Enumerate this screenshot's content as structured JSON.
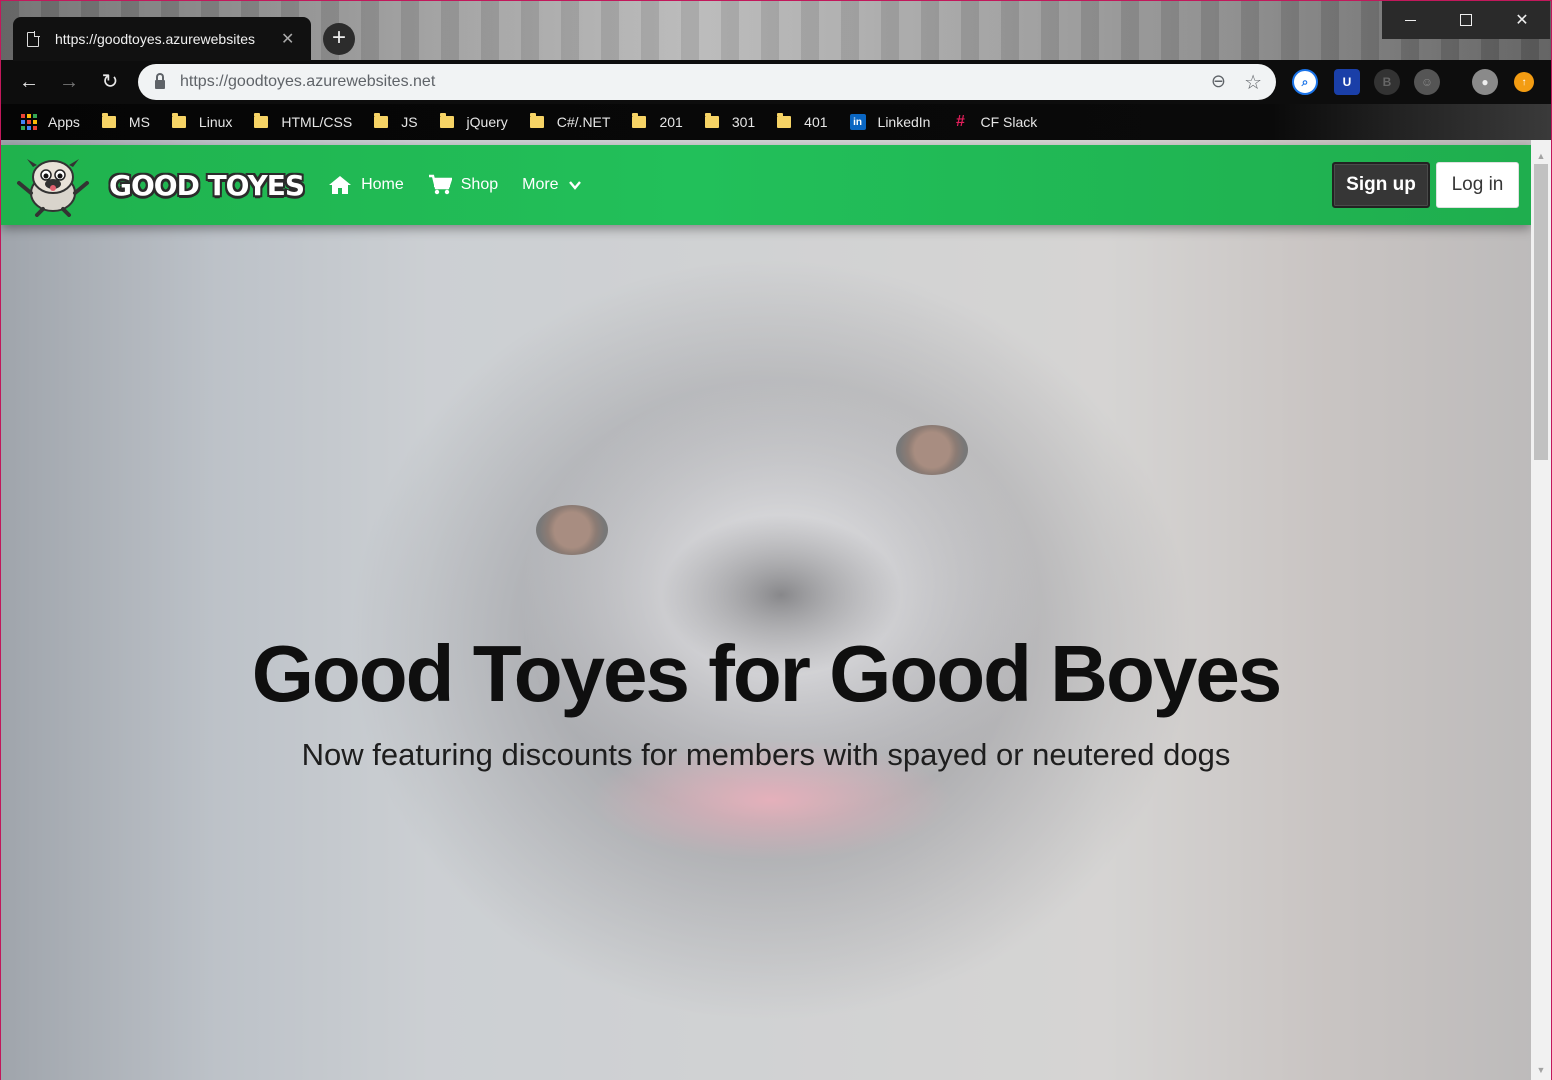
{
  "browser": {
    "tab_title": "https://goodtoyes.azurewebsites",
    "url": "https://goodtoyes.azurewebsites.net",
    "bookmarks": [
      {
        "label": "Apps",
        "icon": "apps-grid-icon"
      },
      {
        "label": "MS",
        "icon": "folder-icon"
      },
      {
        "label": "Linux",
        "icon": "folder-icon"
      },
      {
        "label": "HTML/CSS",
        "icon": "folder-icon"
      },
      {
        "label": "JS",
        "icon": "folder-icon"
      },
      {
        "label": "jQuery",
        "icon": "folder-icon"
      },
      {
        "label": "C#/.NET",
        "icon": "folder-icon"
      },
      {
        "label": "201",
        "icon": "folder-icon"
      },
      {
        "label": "301",
        "icon": "folder-icon"
      },
      {
        "label": "401",
        "icon": "folder-icon"
      },
      {
        "label": "LinkedIn",
        "icon": "linkedin-icon"
      },
      {
        "label": "CF Slack",
        "icon": "slack-icon"
      }
    ]
  },
  "site": {
    "brand": "GOOD TOYES",
    "nav": [
      {
        "label": "Home",
        "icon": "home-icon"
      },
      {
        "label": "Shop",
        "icon": "cart-icon"
      },
      {
        "label": "More",
        "icon": "chevron-down-icon"
      }
    ],
    "signup_label": "Sign up",
    "login_label": "Log in",
    "hero_title": "Good Toyes for Good Boyes",
    "hero_subtitle": "Now featuring discounts for members with spayed or neutered dogs",
    "colors": {
      "navbar": "#22c05a",
      "button_dark": "#363636",
      "button_light": "#ffffff"
    }
  }
}
